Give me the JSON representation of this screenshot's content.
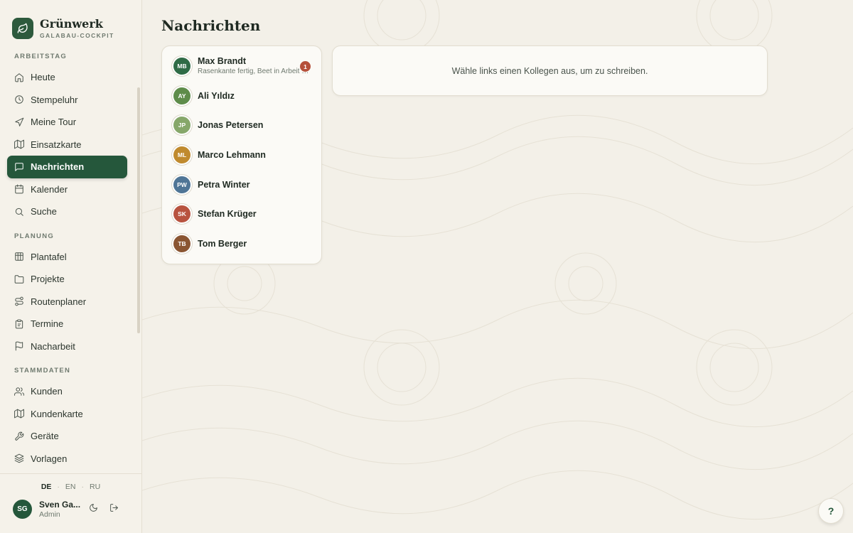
{
  "brand": {
    "name": "Grünwerk",
    "subtitle": "GALABAU-COCKPIT"
  },
  "sections": [
    {
      "label": "ARBEITSTAG",
      "items": [
        {
          "label": "Heute",
          "icon": "home-icon"
        },
        {
          "label": "Stempeluhr",
          "icon": "clock-icon"
        },
        {
          "label": "Meine Tour",
          "icon": "navigation-icon"
        },
        {
          "label": "Einsatzkarte",
          "icon": "map-icon"
        },
        {
          "label": "Nachrichten",
          "icon": "message-icon",
          "active": true
        },
        {
          "label": "Kalender",
          "icon": "calendar-icon"
        },
        {
          "label": "Suche",
          "icon": "search-icon"
        }
      ]
    },
    {
      "label": "PLANUNG",
      "items": [
        {
          "label": "Plantafel",
          "icon": "grid-icon"
        },
        {
          "label": "Projekte",
          "icon": "folder-icon"
        },
        {
          "label": "Routenplaner",
          "icon": "route-icon"
        },
        {
          "label": "Termine",
          "icon": "clipboard-icon"
        },
        {
          "label": "Nacharbeit",
          "icon": "flag-icon"
        }
      ]
    },
    {
      "label": "STAMMDATEN",
      "items": [
        {
          "label": "Kunden",
          "icon": "users-icon"
        },
        {
          "label": "Kundenkarte",
          "icon": "map-icon"
        },
        {
          "label": "Geräte",
          "icon": "wrench-icon"
        },
        {
          "label": "Vorlagen",
          "icon": "layers-icon"
        }
      ]
    }
  ],
  "languages": {
    "de": "DE",
    "en": "EN",
    "ru": "RU",
    "separator": "·"
  },
  "user": {
    "initials": "SG",
    "name": "Sven Ga...",
    "role": "Admin"
  },
  "page": {
    "title": "Nachrichten"
  },
  "contacts": [
    {
      "initials": "MB",
      "name": "Max Brandt",
      "preview": "Rasenkante fertig, Beet in Arbeit …",
      "unread": "1",
      "color": "#2f6b46"
    },
    {
      "initials": "AY",
      "name": "Ali Yıldız",
      "color": "#5e8c4a"
    },
    {
      "initials": "JP",
      "name": "Jonas Petersen",
      "color": "#86a76a"
    },
    {
      "initials": "ML",
      "name": "Marco Lehmann",
      "color": "#c08a2e"
    },
    {
      "initials": "PW",
      "name": "Petra Winter",
      "color": "#4f7596"
    },
    {
      "initials": "SK",
      "name": "Stefan Krüger",
      "color": "#b8533f"
    },
    {
      "initials": "TB",
      "name": "Tom Berger",
      "color": "#8a5532"
    }
  ],
  "chat": {
    "empty_text": "Wähle links einen Kollegen aus, um zu schreiben."
  },
  "help": {
    "label": "?"
  }
}
